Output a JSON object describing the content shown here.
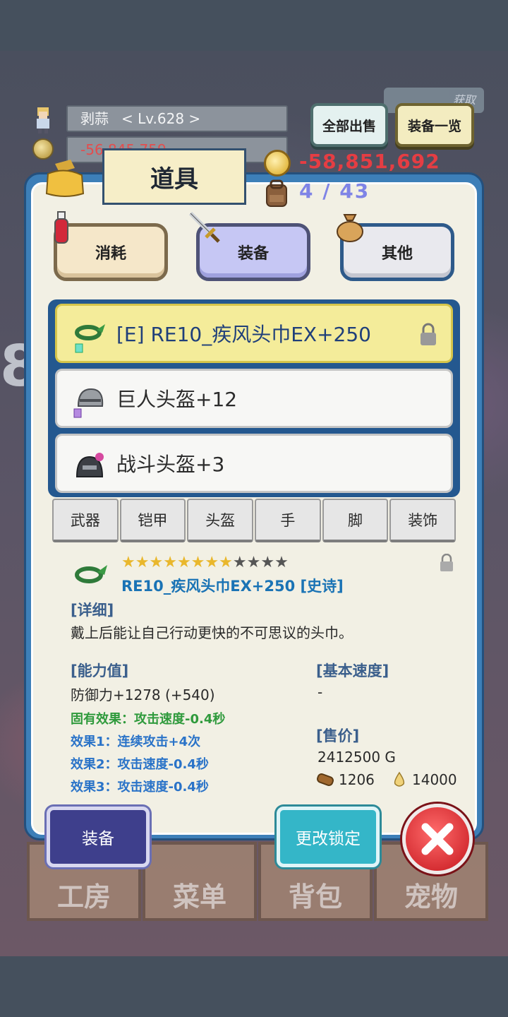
{
  "header": {
    "player_name": "剥蒜",
    "level": "< Lv.628 >",
    "gold_partial": "-56,845,759",
    "get_badge": "获取",
    "sell_all_label": "全部出售",
    "equip_list_label": "装备一览"
  },
  "panel": {
    "title": "道具",
    "money": "-58,851,692",
    "capacity": "4 / 43"
  },
  "categories": [
    {
      "label": "消耗"
    },
    {
      "label": "装备"
    },
    {
      "label": "其他"
    }
  ],
  "items": [
    {
      "name": "[E] RE10_疾风头巾EX+250",
      "selected": true,
      "locked": true
    },
    {
      "name": "巨人头盔+12",
      "selected": false,
      "locked": false
    },
    {
      "name": "战斗头盔+3",
      "selected": false,
      "locked": false
    }
  ],
  "slot_tabs": [
    {
      "label": "武器"
    },
    {
      "label": "铠甲"
    },
    {
      "label": "头盔"
    },
    {
      "label": "手"
    },
    {
      "label": "脚"
    },
    {
      "label": "装饰"
    }
  ],
  "detail": {
    "stars_filled": 8,
    "stars_total": 12,
    "name": "RE10_疾风头巾EX+250 [史诗]",
    "detail_label": "[详细]",
    "description": "戴上后能让自己行动更快的不可思议的头巾。",
    "ability_label": "[能力值]",
    "defense": "防御力+1278 (+540)",
    "inherent_effect": "固有效果：攻击速度-0.4秒",
    "effect1": "效果1：连续攻击+4次",
    "effect2": "效果2：攻击速度-0.4秒",
    "effect3": "效果3：攻击速度-0.4秒",
    "base_speed_label": "[基本速度]",
    "base_speed": "-",
    "price_label": "[售价]",
    "price": "2412500 G",
    "material_count": "1206",
    "drop_count": "14000"
  },
  "bottom_nav": [
    {
      "label": "工房"
    },
    {
      "label": "菜单"
    },
    {
      "label": "背包"
    },
    {
      "label": "宠物"
    }
  ],
  "actions": {
    "equip_label": "装备",
    "change_lock_label": "更改锁定"
  },
  "colors": {
    "panel_blue": "#3d7fb8",
    "money_red": "#e53d43",
    "capacity_purple": "#7f84e6",
    "selected_item": "#f4ec9a",
    "effect_green": "#2f9a3c",
    "effect_blue": "#2a73c8"
  }
}
